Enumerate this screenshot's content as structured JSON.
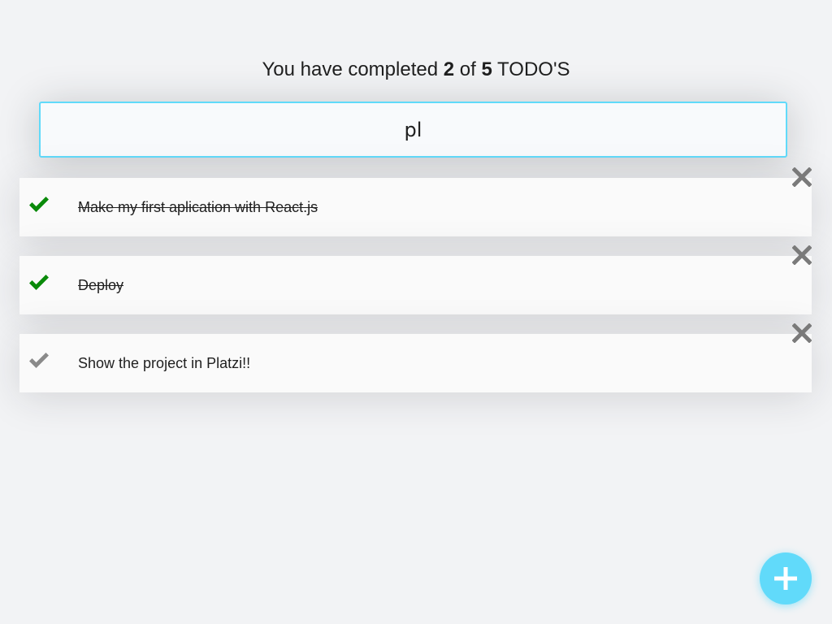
{
  "counter": {
    "prefix": "You have completed",
    "completed": "2",
    "middle": "of",
    "total": "5",
    "suffix": "TODO'S"
  },
  "search": {
    "value": "pl",
    "icon": "none"
  },
  "todos": [
    {
      "text": "Make my first aplication with React.js",
      "completed": true
    },
    {
      "text": "Deploy",
      "completed": true
    },
    {
      "text": "Show the project in Platzi!!",
      "completed": false
    }
  ],
  "icons": {
    "check": "check-icon",
    "delete": "close-icon",
    "add": "plus-icon"
  },
  "colors": {
    "accent": "#61dafa",
    "done_check": "#0a8a0a",
    "pending_check": "#8a8a8a",
    "delete": "#7a7a7a",
    "background": "#f2f3f5"
  }
}
